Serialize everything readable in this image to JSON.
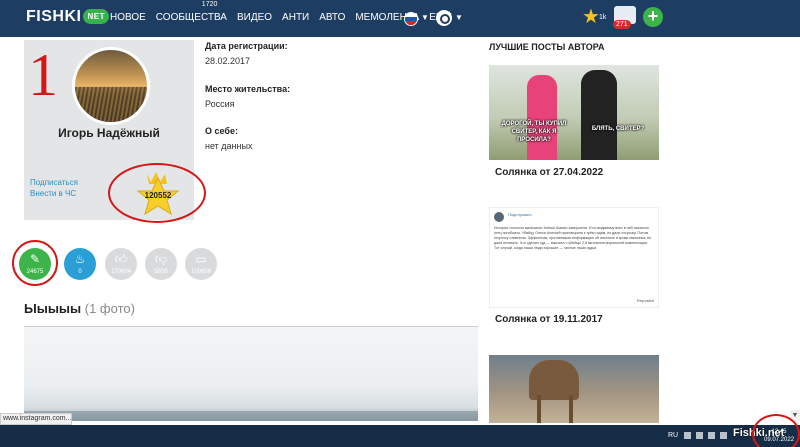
{
  "nav": {
    "logo": "FISHKI",
    "logo_suffix": "NET",
    "items": [
      "НОВОЕ",
      "СООБЩЕСТВА",
      "ВИДЕО",
      "АНТИ",
      "АВТО",
      "МЕМОЛЕНТА",
      "ЕЩЁ"
    ],
    "communities_badge": "1720",
    "stars_count": "1k",
    "messages_badge": "271",
    "add_label": "+"
  },
  "profile": {
    "annotation_number": "1",
    "username": "Игорь Надёжный",
    "subscribe": "Подписаться",
    "blacklist": "Внести в ЧС",
    "rating": "120552"
  },
  "info": {
    "reg_label": "Дата регистрации:",
    "reg_value": "28.02.2017",
    "location_label": "Место жительства:",
    "location_value": "Россия",
    "about_label": "О себе:",
    "about_value": "нет данных"
  },
  "stats": [
    {
      "icon": "pencil-icon",
      "value": "24675"
    },
    {
      "icon": "flame-icon",
      "value": "0"
    },
    {
      "icon": "thumbs-up-icon",
      "value": "170604"
    },
    {
      "icon": "thumbs-down-icon",
      "value": "5656"
    },
    {
      "icon": "comment-icon",
      "value": "109656"
    }
  ],
  "photos": {
    "title": "Ыыыыы",
    "count": "(1 фото)"
  },
  "best_posts": {
    "title": "ЛУЧШИЕ ПОСТЫ АВТОРА",
    "caption_left": "ДОРОГОЙ, ТЫ КУПИЛ СВИТЕР, КАК Я ПРОСИЛА?",
    "caption_right": "БЛЯТЬ, СВИТЕР?",
    "post1": "Солянка от 27.04.2022",
    "post2": "Солянка от 19.11.2017",
    "doc_name": "Подслушано",
    "doc_text": "История «плохого мальчика» Алёши Шамко завершена. И по-видимому всех в ней оказался отец погибшего. Убийцу Олеся Алексей приговорили к трём годам, но дали отсрочку. Потом отсрочку отменили. Эффектная, противником информацию об алкоголе в крови мальчика, не дали печатать. Что сделал суд — взыскал с убийцы 2,5 миллиона моральной компенсации. Тот случай, когда наши люди хорошие — чистые наши судьи.",
    "doc_tag": "Reposted"
  },
  "taskbar": {
    "status_url": "www.instagram.com...",
    "lang": "RU",
    "watermark": "Fishki.net",
    "time": "12:45",
    "date": "09.07.2022"
  },
  "colors": {
    "nav_bg": "#1d3d63",
    "link": "#2a8fc4",
    "annotation_red": "#d41818",
    "green": "#3cb44a",
    "blue": "#2a9fd6"
  }
}
